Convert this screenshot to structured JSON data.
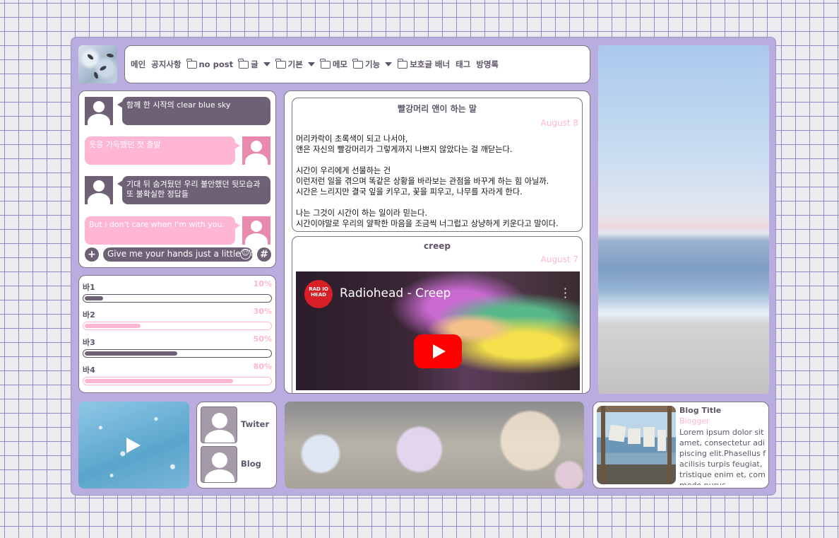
{
  "nav": {
    "items": [
      {
        "label": "메인",
        "folder": false,
        "caret": false
      },
      {
        "label": "공지사항",
        "folder": false,
        "caret": false
      },
      {
        "label": "no post",
        "folder": true,
        "caret": false
      },
      {
        "label": "글",
        "folder": true,
        "caret": true
      },
      {
        "label": "기본",
        "folder": true,
        "caret": true
      },
      {
        "label": "메모",
        "folder": true,
        "caret": false
      },
      {
        "label": "기능",
        "folder": true,
        "caret": true
      },
      {
        "label": "보호글 배너",
        "folder": true,
        "caret": false
      },
      {
        "label": "태그",
        "folder": false,
        "caret": false
      },
      {
        "label": "방명록",
        "folder": false,
        "caret": false
      }
    ]
  },
  "chat": {
    "messages": [
      {
        "side": "left",
        "text": "함께 한 시작의 clear blue sky"
      },
      {
        "side": "right",
        "text": "웃음 가득했던 첫 출발"
      },
      {
        "side": "left",
        "text": "기대 뒤 숨겨뒀던 우리 불안했던 뒷모습과 또 불확실한 정답들"
      },
      {
        "side": "right",
        "text": "But i don't care when I'm with you."
      }
    ],
    "composer": {
      "plus_label": "+",
      "input_value": "Give me your hands just a little bit",
      "smile_label": "☺",
      "hash_label": "#"
    }
  },
  "bars": [
    {
      "label": "바1",
      "percent_label": "10%",
      "value": 0.1,
      "style": "dark"
    },
    {
      "label": "바2",
      "percent_label": "30%",
      "value": 0.3,
      "style": "pink"
    },
    {
      "label": "바3",
      "percent_label": "50%",
      "value": 0.5,
      "style": "dark"
    },
    {
      "label": "바4",
      "percent_label": "80%",
      "value": 0.8,
      "style": "pink"
    }
  ],
  "posts": [
    {
      "title": "빨강머리 앤이 하는 말",
      "date": "August 8",
      "body": "머리카락이 초록색이 되고 나서야,\n앤은 자신의 빨강머리가 그렇게까지 나쁘지 않았다는 걸 깨닫는다.\n\n시간이 우리에게 선물하는 건\n이런저런 일을 겪으며 똑같은 상황을 바라보는 관점을 바꾸게 하는 힘 아닐까.\n시간은 느리지만 결국 잎을 키우고, 꽃을 피우고, 나무를 자라게 한다.\n\n나는 그것이 시간이 하는 일이라 믿는다.\n시간이야말로 우리의 얄팍한 마음을 조금씩 너그럽고 상냥하게 키운다고 말이다."
    },
    {
      "title": "creep",
      "date": "August 7",
      "video": {
        "channel_logo": "RAD IO HEAD",
        "title": "Radiohead - Creep"
      }
    }
  ],
  "links": [
    {
      "label": "Twiter"
    },
    {
      "label": "Blog"
    }
  ],
  "blog": {
    "title": "Blog Title",
    "subtitle": "Blogger",
    "description": "Lorem ipsum dolor sit amet, consectetur adipiscing elit.Phasellus facilisis turpis feugiat, tristique enim et, commodo purus."
  },
  "colors": {
    "frame": "#b9acdf",
    "dark_accent": "#6e6176",
    "pink_accent": "#ffb6d2",
    "text": "#5e5668"
  }
}
